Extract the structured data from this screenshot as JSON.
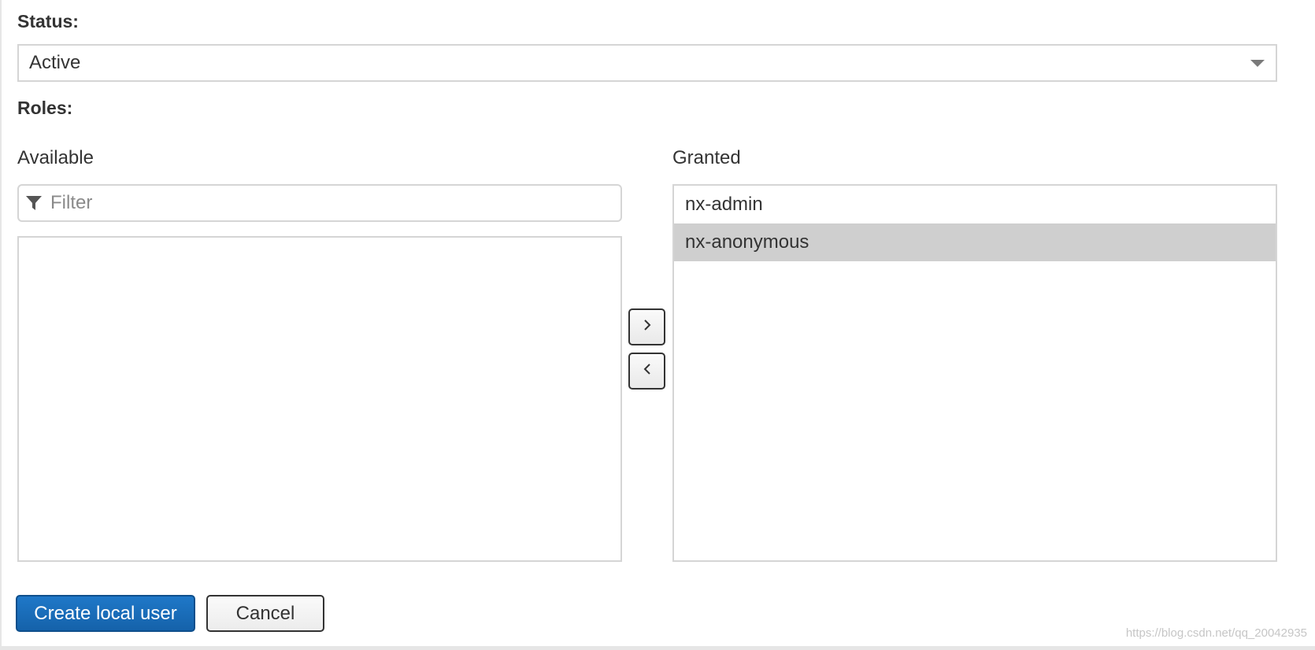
{
  "status": {
    "label": "Status:",
    "value": "Active",
    "caret_icon": "caret-down-icon"
  },
  "roles": {
    "label": "Roles:",
    "available": {
      "heading": "Available",
      "filter_placeholder": "Filter",
      "filter_value": "",
      "filter_icon": "funnel-icon",
      "items": []
    },
    "granted": {
      "heading": "Granted",
      "items": [
        "nx-admin",
        "nx-anonymous"
      ],
      "selected_index": 1
    },
    "controls": {
      "add_icon": "chevron-right-icon",
      "remove_icon": "chevron-left-icon"
    }
  },
  "actions": {
    "create_label": "Create local user",
    "cancel_label": "Cancel"
  },
  "watermark": "https://blog.csdn.net/qq_20042935",
  "colors": {
    "primary": "#1a6dbb",
    "selected_row": "#cfcfcf",
    "border": "#d5d5d5"
  }
}
